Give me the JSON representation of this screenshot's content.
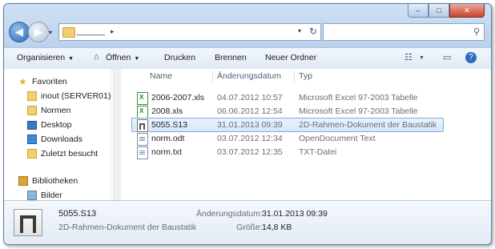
{
  "window": {
    "caption_buttons": {
      "minimize": "–",
      "maximize": "□",
      "close": "✕"
    }
  },
  "nav_buttons": {
    "back": "◀",
    "forward": "▶",
    "dropdown": "▾"
  },
  "address_bar": {
    "breadcrumb": "______",
    "separator": "▸",
    "dropdown": "▾",
    "refresh": "↻"
  },
  "search": {
    "placeholder": "",
    "icon": "search-icon"
  },
  "toolbar": {
    "organize": "Organisieren",
    "open": "Öffnen",
    "print": "Drucken",
    "burn": "Brennen",
    "new_folder": "Neuer Ordner",
    "view_icon": "☷",
    "preview_icon": "▭",
    "help_icon": "?"
  },
  "sidebar": {
    "favorites": {
      "label": "Favoriten",
      "items": [
        {
          "label": "inout (SERVER01)",
          "icon": "user-folder-icon"
        },
        {
          "label": "Normen",
          "icon": "folder-icon"
        },
        {
          "label": "Desktop",
          "icon": "desktop-icon"
        },
        {
          "label": "Downloads",
          "icon": "downloads-icon"
        },
        {
          "label": "Zuletzt besucht",
          "icon": "recent-places-icon"
        }
      ]
    },
    "libraries": {
      "label": "Bibliotheken",
      "items": [
        {
          "label": "Bilder",
          "icon": "pictures-icon"
        }
      ]
    }
  },
  "file_list": {
    "columns": {
      "name": "Name",
      "modified": "Änderungsdatum",
      "type": "Typ"
    },
    "rows": [
      {
        "name": "2006-2007.xls",
        "modified": "04.07.2012 10:57",
        "type": "Microsoft Excel 97-2003 Tabelle",
        "icon": "excel-file-icon"
      },
      {
        "name": "2008.xls",
        "modified": "06.06.2012 12:54",
        "type": "Microsoft Excel 97-2003 Tabelle",
        "icon": "excel-file-icon"
      },
      {
        "name": "5055.S13",
        "modified": "31.01.2013 09:39",
        "type": "2D-Rahmen-Dokument der Baustatik",
        "icon": "frame-document-icon",
        "selected": true
      },
      {
        "name": "norm.odt",
        "modified": "03.07.2012 12:34",
        "type": "OpenDocument Text",
        "icon": "document-file-icon"
      },
      {
        "name": "norm.txt",
        "modified": "03.07.2012 12:35",
        "type": "TXT-Datei",
        "icon": "text-file-icon"
      }
    ]
  },
  "details_pane": {
    "name": "5055.S13",
    "type": "2D-Rahmen-Dokument der Baustatik",
    "modified_label": "Änderungsdatum:",
    "modified_value": "31.01.2013 09:39",
    "size_label": "Größe:",
    "size_value": "14,8 KB"
  }
}
